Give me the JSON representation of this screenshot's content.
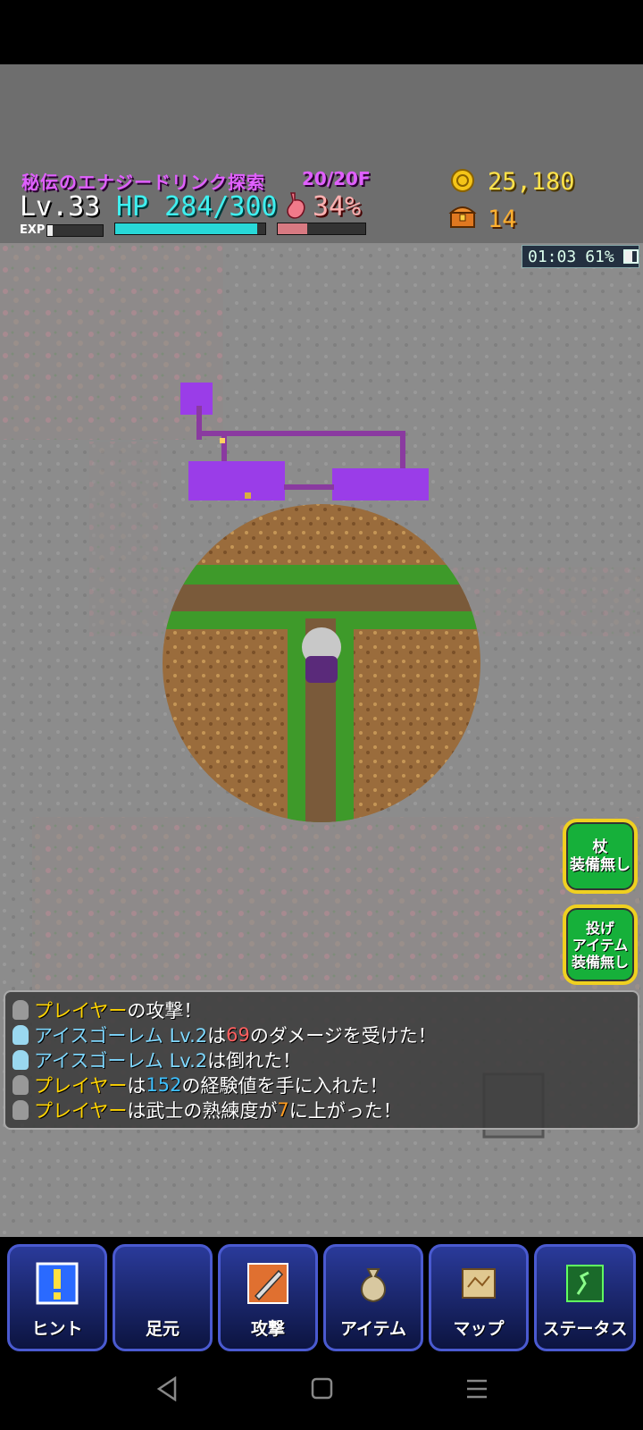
{
  "hud": {
    "dungeon_name": "秘伝のエナジードリンク探索",
    "floor": "20/20F",
    "level": "Lv.33",
    "hp_text": "HP 284/300",
    "hp_fraction": 0.947,
    "hunger_text": "34%",
    "hunger_fraction": 0.34,
    "exp_label": "EXP",
    "exp_fraction": 0.1,
    "gold": "25,180",
    "chests": "14"
  },
  "overlay": {
    "time": "01:03",
    "battery": "61%"
  },
  "side_buttons": {
    "staff_line1": "杖",
    "staff_line2": "装備無し",
    "throw_line1": "投げ",
    "throw_line2": "アイテム",
    "throw_line3": "装備無し"
  },
  "log": [
    {
      "name": "プレイヤー",
      "rest": "の攻撃！"
    },
    {
      "name": "アイスゴーレム Lv.2",
      "pre": "は",
      "num": "69",
      "rest": "のダメージを受けた！"
    },
    {
      "name": "アイスゴーレム Lv.2",
      "rest": "は倒れた！"
    },
    {
      "name": "プレイヤー",
      "pre": "は",
      "num": "152",
      "rest": "の経験値を手に入れた！"
    },
    {
      "name": "プレイヤー",
      "pre": "は武士の熟練度が",
      "num": "7",
      "rest": "に上がった！"
    }
  ],
  "menu": {
    "hint": "ヒント",
    "feet": "足元",
    "attack": "攻撃",
    "item": "アイテム",
    "map": "マップ",
    "status": "ステータス"
  },
  "colors": {
    "hp": "#3ff0f0",
    "minimap": "#9a3de8",
    "side_button": "#16b03a"
  }
}
